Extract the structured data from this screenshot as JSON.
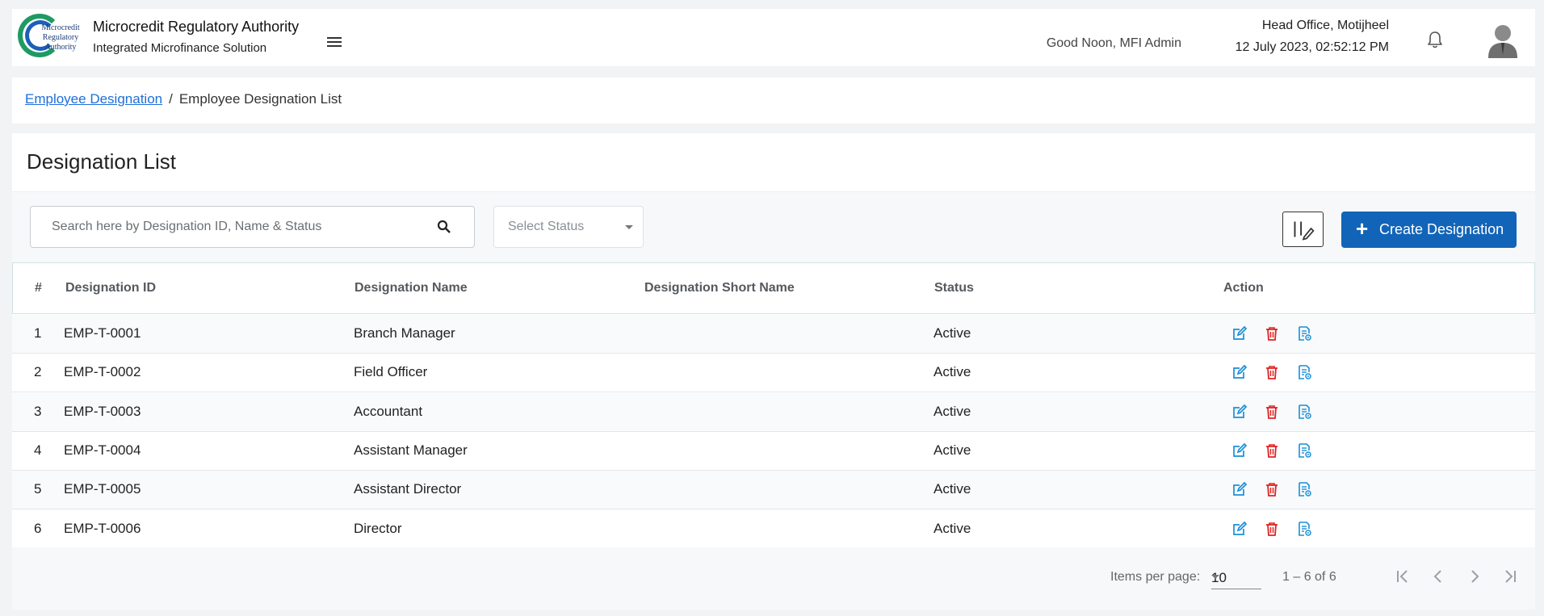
{
  "header": {
    "logo_text": "Microcredit Regulatory Authority",
    "org_title": "Microcredit Regulatory Authority",
    "org_subtitle": "Integrated Microfinance Solution",
    "greeting": "Good Noon, MFI Admin",
    "office": "Head Office, Motijheel",
    "datetime": "12 July 2023, 02:52:12 PM"
  },
  "breadcrumb": {
    "link": "Employee Designation",
    "separator": "/",
    "current": "Employee Designation List"
  },
  "page": {
    "title": "Designation List"
  },
  "filters": {
    "search_placeholder": "Search here by Designation ID, Name & Status",
    "status_placeholder": "Select Status",
    "create_label": "Create Designation"
  },
  "table": {
    "headers": [
      "#",
      "Designation ID",
      "Designation Name",
      "Designation Short Name",
      "Status",
      "Action"
    ],
    "rows": [
      {
        "no": "1",
        "id": "EMP-T-0001",
        "name": "Branch Manager",
        "short": "",
        "status": "Active"
      },
      {
        "no": "2",
        "id": "EMP-T-0002",
        "name": "Field Officer",
        "short": "",
        "status": "Active"
      },
      {
        "no": "3",
        "id": "EMP-T-0003",
        "name": "Accountant",
        "short": "",
        "status": "Active"
      },
      {
        "no": "4",
        "id": "EMP-T-0004",
        "name": "Assistant Manager",
        "short": "",
        "status": "Active"
      },
      {
        "no": "5",
        "id": "EMP-T-0005",
        "name": "Assistant Director",
        "short": "",
        "status": "Active"
      },
      {
        "no": "6",
        "id": "EMP-T-0006",
        "name": "Director",
        "short": "",
        "status": "Active"
      }
    ]
  },
  "pagination": {
    "items_label": "Items per page:",
    "page_size": "10",
    "range": "1 – 6 of 6"
  },
  "colors": {
    "primary": "#1264b8",
    "edit": "#1a8fd6",
    "delete": "#e02424",
    "view": "#1a8fd6"
  }
}
